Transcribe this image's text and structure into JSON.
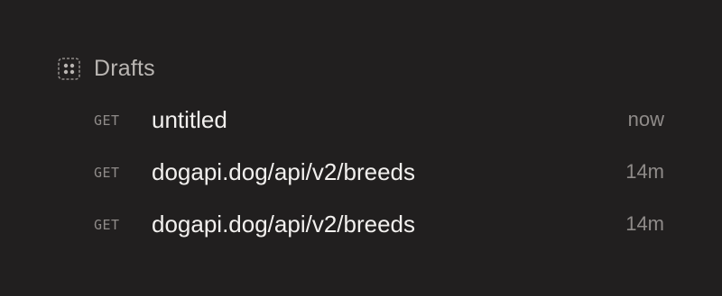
{
  "drafts_section": {
    "title": "Drafts",
    "icon": "drafts-grid-icon"
  },
  "requests": [
    {
      "method": "GET",
      "name": "untitled",
      "time": "now"
    },
    {
      "method": "GET",
      "name": "dogapi.dog/api/v2/breeds",
      "time": "14m"
    },
    {
      "method": "GET",
      "name": "dogapi.dog/api/v2/breeds",
      "time": "14m"
    }
  ],
  "colors": {
    "background": "#211f1f",
    "title": "#b9b5b2",
    "request_name": "#f2f0ee",
    "muted": "#8f8b89"
  }
}
